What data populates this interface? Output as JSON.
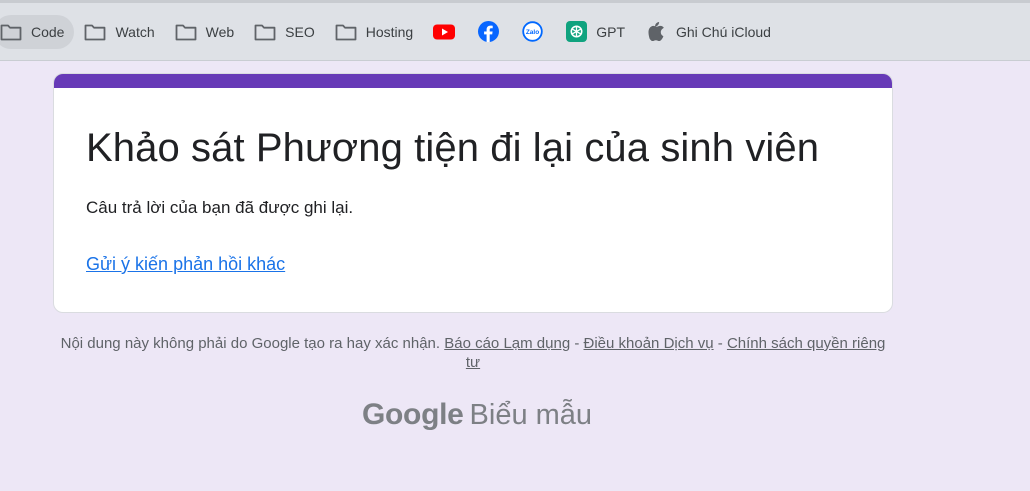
{
  "bookmarks": {
    "items": [
      {
        "label": "Code",
        "icon": "folder-icon",
        "active": true
      },
      {
        "label": "Watch",
        "icon": "folder-icon"
      },
      {
        "label": "Web",
        "icon": "folder-icon"
      },
      {
        "label": "SEO",
        "icon": "folder-icon"
      },
      {
        "label": "Hosting",
        "icon": "folder-icon"
      },
      {
        "label": "",
        "icon": "youtube-icon"
      },
      {
        "label": "",
        "icon": "facebook-icon"
      },
      {
        "label": "",
        "icon": "zalo-icon",
        "icon_text": "Zalo"
      },
      {
        "label": "GPT",
        "icon": "openai-icon"
      },
      {
        "label": "Ghi Chú iCloud",
        "icon": "apple-icon"
      }
    ]
  },
  "form": {
    "title": "Khảo sát Phương tiện đi lại của sinh viên",
    "confirmation": "Câu trả lời của bạn đã được ghi lại.",
    "another_response_link": "Gửi ý kiến phản hồi khác",
    "accent_color": "#673ab7"
  },
  "footer": {
    "disclaimer_text": "Nội dung này không phải do Google tạo ra hay xác nhận.",
    "report_abuse": "Báo cáo Lạm dụng",
    "separator": "-",
    "terms": "Điều khoản Dịch vụ",
    "privacy": "Chính sách quyền riêng tư",
    "logo_google": "Google",
    "logo_product": "Biểu mẫu"
  },
  "colors": {
    "page_background": "#ede7f6",
    "link": "#1a73e8",
    "youtube": "#ff0000",
    "facebook": "#0866ff",
    "zalo": "#0068ff",
    "gpt": "#10a37f"
  }
}
